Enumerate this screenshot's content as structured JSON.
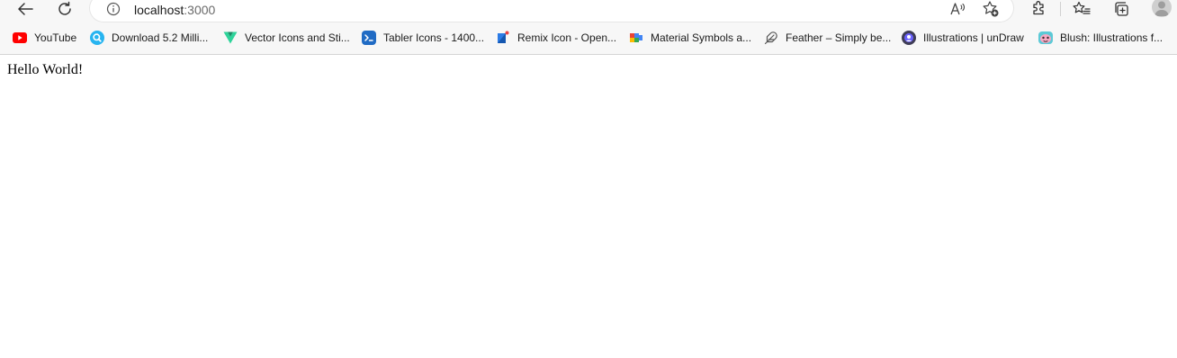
{
  "address_bar": {
    "url_host": "localhost",
    "url_port": ":3000"
  },
  "toolbar_icons": [
    "back-arrow-icon",
    "refresh-icon",
    "info-icon",
    "read-aloud-icon",
    "add-favorite-icon",
    "extensions-icon",
    "favorites-icon",
    "collections-icon",
    "profile-avatar-icon"
  ],
  "favorites": [
    {
      "label": "YouTube",
      "icon": "youtube-icon",
      "color": "#ff0000"
    },
    {
      "label": "Download 5.2 Milli...",
      "icon": "iconscout-icon",
      "color": "#27b4f0"
    },
    {
      "label": "Vector Icons and Sti...",
      "icon": "vector-icons-icon",
      "color": "#2ed39a"
    },
    {
      "label": "Tabler Icons - 1400...",
      "icon": "tabler-icon",
      "color": "#206bc4"
    },
    {
      "label": "Remix Icon - Open...",
      "icon": "remix-icon",
      "color": "#2c7be5"
    },
    {
      "label": "Material Symbols a...",
      "icon": "material-symbols-icon",
      "color": "#ea4335"
    },
    {
      "label": "Feather – Simply be...",
      "icon": "feather-icon",
      "color": "#555555"
    },
    {
      "label": "Illustrations | unDraw",
      "icon": "undraw-icon",
      "color": "#3f3d56"
    },
    {
      "label": "Blush: Illustrations f...",
      "icon": "blush-icon",
      "color": "#5cc9d6"
    }
  ],
  "page": {
    "text": "Hello World!"
  }
}
